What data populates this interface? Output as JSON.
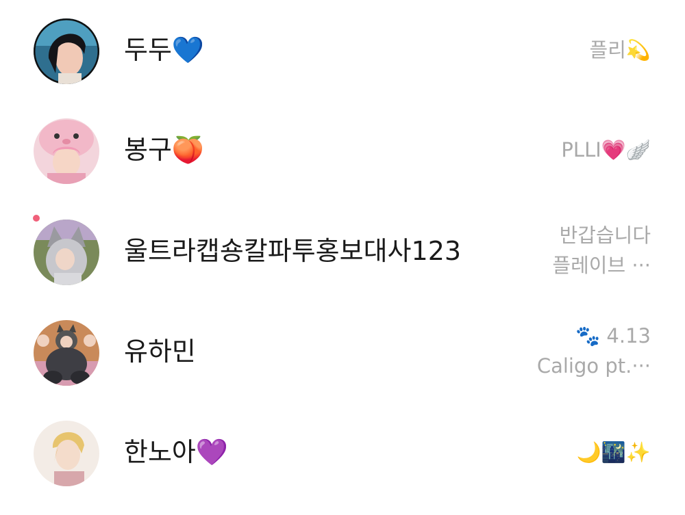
{
  "friends": [
    {
      "name": "두두💙",
      "status_line1": "플리💫",
      "status_line2": "",
      "avatar": "avatar-dark-hair-boy"
    },
    {
      "name": "봉구🍑",
      "status_line1": "PLLI💗🪽",
      "status_line2": "",
      "avatar": "avatar-pink-hood"
    },
    {
      "name": "울트라캡숑칼파투홍보대사123",
      "status_line1": "반갑습니다",
      "status_line2": "플레이브 ···",
      "avatar": "avatar-wolf-hood"
    },
    {
      "name": "유하민",
      "status_line1": "🐾 4.13",
      "status_line2": "Caligo pt.···",
      "avatar": "avatar-cat-costume"
    },
    {
      "name": "한노아💜",
      "status_line1": "🌙🌃✨",
      "status_line2": "",
      "avatar": "avatar-blond-boy"
    }
  ],
  "colors": {
    "background": "#ffffff",
    "name_text": "#1a1a1a",
    "status_text": "#a9a9a9",
    "new_dot": "#f0607a"
  }
}
